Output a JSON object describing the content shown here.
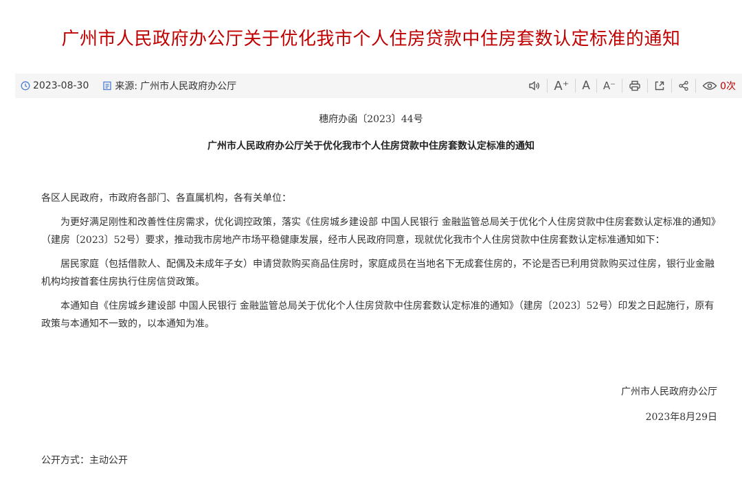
{
  "page": {
    "title": "广州市人民政府办公厅关于优化我市个人住房贷款中住房套数认定标准的通知"
  },
  "meta": {
    "date": "2023-08-30",
    "source_label": "来源:",
    "source": "广州市人民政府办公厅",
    "views": "0次"
  },
  "toolbar": {
    "font_increase_label": "A⁺",
    "font_default_label": "A",
    "font_decrease_label": "A⁻"
  },
  "document": {
    "number": "穗府办函〔2023〕44号",
    "title": "广州市人民政府办公厅关于优化我市个人住房贷款中住房套数认定标准的通知",
    "salutation": "各区人民政府，市政府各部门、各直属机构，各有关单位：",
    "paragraphs": [
      "为更好满足刚性和改善性住房需求，优化调控政策，落实《住房城乡建设部 中国人民银行 金融监管总局关于优化个人住房贷款中住房套数认定标准的通知》（建房〔2023〕52号）要求，推动我市房地产市场平稳健康发展，经市人民政府同意，现就优化我市个人住房贷款中住房套数认定标准通知如下：",
      "居民家庭（包括借款人、配偶及未成年子女）申请贷款购买商品住房时，家庭成员在当地名下无成套住房的，不论是否已利用贷款购买过住房，银行业金融机构均按首套住房执行住房信贷政策。",
      "本通知自《住房城乡建设部 中国人民银行 金融监管总局关于优化个人住房贷款中住房套数认定标准的通知》（建房〔2023〕52号）印发之日起施行，原有政策与本通知不一致的，以本通知为准。"
    ],
    "signer": "广州市人民政府办公厅",
    "sign_date": "2023年8月29日",
    "disclosure": "公开方式：主动公开"
  },
  "colors": {
    "title": "#c00000",
    "accent_icon": "#4a7bd0",
    "meta_bar_bg": "#f5f5f5",
    "views": "#c00000"
  },
  "icons": [
    "clock-icon",
    "document-icon",
    "speaker-icon",
    "print-icon",
    "share-box-icon",
    "share-icon",
    "eye-icon"
  ]
}
